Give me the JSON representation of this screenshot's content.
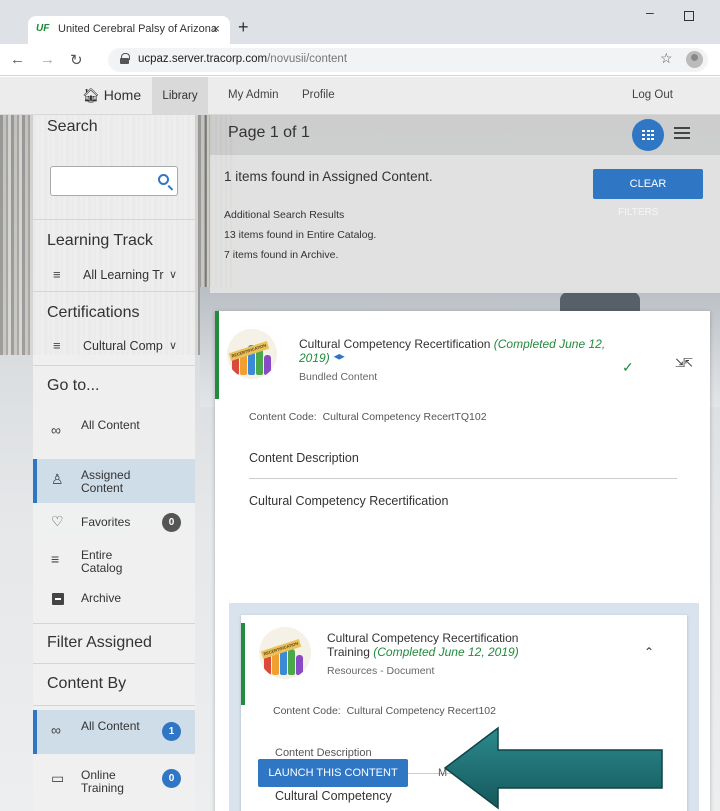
{
  "browser": {
    "tab_logo": "UF",
    "tab_title": "United Cerebral Palsy of Arizona",
    "tab_close": "×",
    "new_tab": "+",
    "url_domain": "ucpaz.server.tracorp.com",
    "url_path": "/novusii/content",
    "icons": [
      "back-icon",
      "forward-icon",
      "reload-icon",
      "lock-icon",
      "star-icon",
      "profile-icon"
    ]
  },
  "topnav": {
    "home": "Home",
    "library": "Library",
    "my_admin": "My Admin",
    "profile": "Profile",
    "logout": "Log Out"
  },
  "sidebar": {
    "search_title": "Search",
    "learning_track_title": "Learning Track",
    "learning_track_value": "All Learning Tr",
    "certifications_title": "Certifications",
    "certifications_value": "Cultural Comp",
    "goto_title": "Go to...",
    "goto_items": [
      {
        "label": "All Content",
        "icon": "infinity-icon"
      },
      {
        "label": "Assigned Content",
        "icon": "person-icon",
        "active": true
      },
      {
        "label": "Favorites",
        "icon": "heart-icon",
        "badge": "0"
      },
      {
        "label": "Entire Catalog",
        "icon": "list-icon"
      },
      {
        "label": "Archive",
        "icon": "archive-icon"
      }
    ],
    "filter_title_1": "Filter Assigned",
    "filter_title_2": "Content By",
    "filter_items": [
      {
        "label": "All Content",
        "icon": "infinity-icon",
        "badge": "1",
        "active": true
      },
      {
        "label": "Online Training",
        "icon": "monitor-icon",
        "badge": "0"
      }
    ]
  },
  "pagebar": {
    "page_label": "Page 1 of 1"
  },
  "results": {
    "main": "1 items found in Assigned Content.",
    "additional": "Additional Search Results",
    "entire_catalog": "13 items found in Entire Catalog.",
    "archive": "7 items found in Archive.",
    "clear_label": "CLEAR",
    "clear_overflow": "FILTERS"
  },
  "card": {
    "title": "Cultural Competency Recertification",
    "completed": "(Completed June 12, 2019)",
    "type": "Bundled Content",
    "code_label": "Content Code:",
    "code_value": "Cultural Competency RecertTQ102",
    "description_heading": "Content Description",
    "description_value": "Cultural Competency Recertification",
    "logo_text": "RECERTIFICATION"
  },
  "inner": {
    "title_line1": "Cultural Competency Recertification",
    "title_line2": "Training",
    "completed": "(Completed June 12, 2019)",
    "type": "Resources - Document",
    "code_label": "Content Code:",
    "code_value": "Cultural Competency Recert102",
    "description_heading": "Content Description",
    "description_value": "Cultural Competency",
    "launch_label": "LAUNCH THIS CONTENT",
    "more_text": "M"
  },
  "colors": {
    "accent": "#2f76c4",
    "completed": "#228b3c",
    "arrow": "#1f6b6e"
  }
}
